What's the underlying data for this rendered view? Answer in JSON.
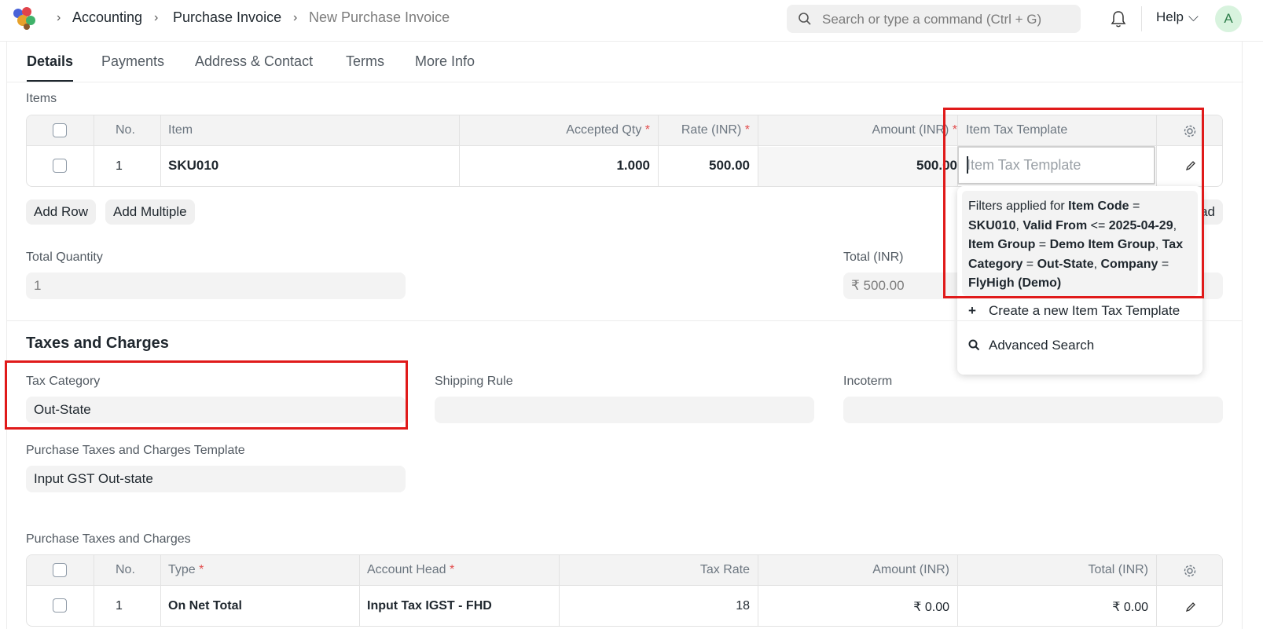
{
  "navbar": {
    "breadcrumbs": [
      "Accounting",
      "Purchase Invoice",
      "New Purchase Invoice"
    ],
    "search_placeholder": "Search or type a command (Ctrl + G)",
    "help_label": "Help",
    "avatar_letter": "A"
  },
  "tabs": [
    "Details",
    "Payments",
    "Address & Contact",
    "Terms",
    "More Info"
  ],
  "items_section": {
    "label": "Items",
    "headers": {
      "no": "No.",
      "item": "Item",
      "accepted_qty": "Accepted Qty",
      "rate": "Rate (INR)",
      "amount": "Amount (INR)",
      "item_tax_template": "Item Tax Template",
      "required_mark": "*"
    },
    "rows": [
      {
        "no": "1",
        "item": "SKU010",
        "accepted_qty": "1.000",
        "rate": "500.00",
        "amount": "500.00"
      }
    ],
    "add_row": "Add Row",
    "add_multiple": "Add Multiple",
    "upload_partial": "ad"
  },
  "totals": {
    "total_quantity_label": "Total Quantity",
    "total_quantity_value": "1",
    "total_label": "Total (INR)",
    "total_value": "₹ 500.00"
  },
  "dropdown": {
    "placeholder": "Item Tax Template",
    "filter_prefix": "Filters applied for ",
    "filters": [
      {
        "field": "Item Code",
        "op": " = ",
        "value": "SKU010"
      },
      {
        "field": "Valid From",
        "op": " <= ",
        "value": "2025-04-29"
      },
      {
        "field": "Item Group",
        "op": " = ",
        "value": "Demo Item Group"
      },
      {
        "field": "Tax Category",
        "op": " = ",
        "value": "Out-State"
      },
      {
        "field": "Company",
        "op": " = ",
        "value": "FlyHigh (Demo)"
      }
    ],
    "create_label": "Create a new Item Tax Template",
    "advanced_search_label": "Advanced Search"
  },
  "taxes_section": {
    "title": "Taxes and Charges",
    "tax_category_label": "Tax Category",
    "tax_category_value": "Out-State",
    "shipping_rule_label": "Shipping Rule",
    "incoterm_label": "Incoterm",
    "template_label": "Purchase Taxes and Charges Template",
    "template_value": "Input GST Out-state",
    "table_label": "Purchase Taxes and Charges",
    "headers": {
      "no": "No.",
      "type": "Type",
      "account_head": "Account Head",
      "tax_rate": "Tax Rate",
      "amount": "Amount (INR)",
      "total": "Total (INR)"
    },
    "rows": [
      {
        "no": "1",
        "type": "On Net Total",
        "account_head": "Input Tax IGST - FHD",
        "tax_rate": "18",
        "amount": "₹ 0.00",
        "total": "₹ 0.00"
      }
    ]
  }
}
